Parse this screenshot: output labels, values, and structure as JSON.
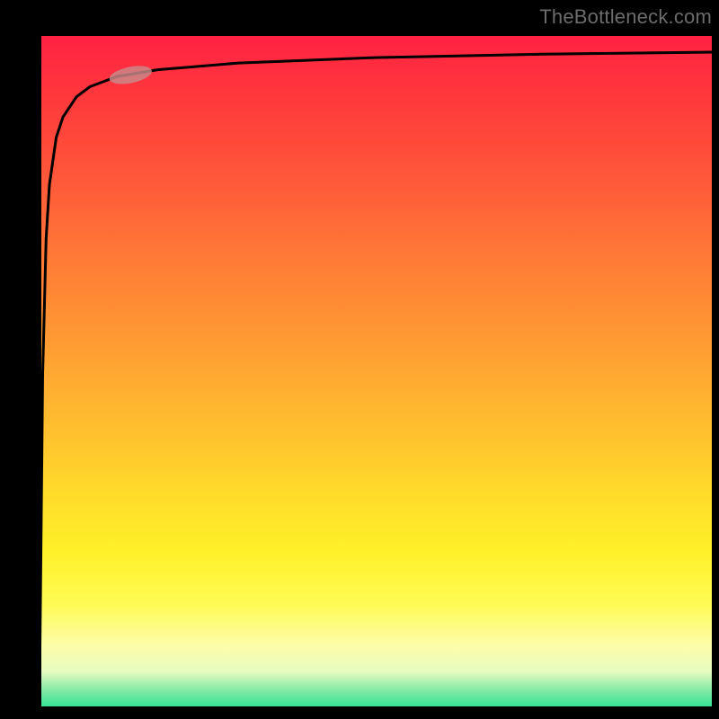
{
  "watermark": "TheBottleneck.com",
  "chart_data": {
    "type": "line",
    "title": "",
    "xlabel": "",
    "ylabel": "",
    "xlim": [
      0,
      100
    ],
    "ylim": [
      0,
      100
    ],
    "series": [
      {
        "name": "curve",
        "x": [
          0.5,
          1,
          1.5,
          2,
          3,
          4,
          6,
          8,
          12,
          18,
          30,
          50,
          75,
          100
        ],
        "y": [
          0,
          50,
          70,
          78,
          85,
          88,
          91,
          92.5,
          94,
          95,
          96,
          96.8,
          97.3,
          97.6
        ]
      }
    ],
    "highlight_segment": {
      "x_start": 11,
      "x_end": 17,
      "note": "pill-shaped marker on curve"
    },
    "gradient_meaning": "vertical red→yellow→green heatmap background"
  },
  "colors": {
    "curve": "#000000",
    "highlight": "#c98a8a",
    "watermark": "#6b6b6b"
  }
}
